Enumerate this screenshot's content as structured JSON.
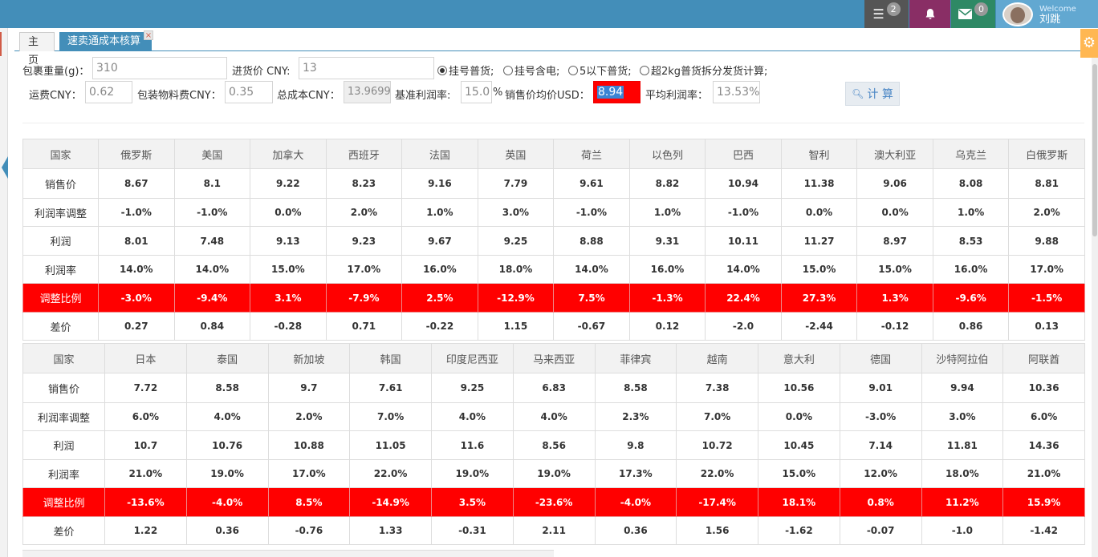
{
  "header": {
    "messages_badge": "2",
    "mail_badge": "0",
    "welcome": "Welcome",
    "username": "刘跳"
  },
  "tabs": [
    {
      "label": "主页"
    },
    {
      "label": "速卖通成本核算",
      "close": "×"
    }
  ],
  "form": {
    "weight_label": "包裹重量(g)：",
    "weight_value": "310",
    "purchase_label": "进货价 CNY:",
    "purchase_value": "13",
    "radio_options": [
      {
        "label": "挂号普货;",
        "checked": true
      },
      {
        "label": "挂号含电;",
        "checked": false
      },
      {
        "label": "5以下普货;",
        "checked": false
      },
      {
        "label": "超2kg普货拆分发货计算;",
        "checked": false
      }
    ],
    "freight_label": "运费CNY：",
    "freight_value": "0.62",
    "packaging_label": "包装物料费CNY：",
    "packaging_value": "0.35",
    "total_cost_label": "总成本CNY：",
    "total_cost_value": "13.9699",
    "base_margin_label": "基准利润率:",
    "base_margin_value": "15.0",
    "percent_sign": "%",
    "avg_price_label": "销售价均价USD：",
    "avg_price_value": "8.94",
    "avg_margin_label": "平均利润率：",
    "avg_margin_value": "13.53%",
    "calc_button": "计 算"
  },
  "row_labels": [
    "国家",
    "销售价",
    "利润率调整",
    "利润",
    "利润率",
    "调整比例",
    "差价"
  ],
  "table1": {
    "countries": [
      "俄罗斯",
      "美国",
      "加拿大",
      "西班牙",
      "法国",
      "英国",
      "荷兰",
      "以色列",
      "巴西",
      "智利",
      "澳大利亚",
      "乌克兰",
      "白俄罗斯"
    ],
    "rows": [
      [
        "8.67",
        "8.1",
        "9.22",
        "8.23",
        "9.16",
        "7.79",
        "9.61",
        "8.82",
        "10.94",
        "11.38",
        "9.06",
        "8.08",
        "8.81"
      ],
      [
        "-1.0%",
        "-1.0%",
        "0.0%",
        "2.0%",
        "1.0%",
        "3.0%",
        "-1.0%",
        "1.0%",
        "-1.0%",
        "0.0%",
        "0.0%",
        "1.0%",
        "2.0%"
      ],
      [
        "8.01",
        "7.48",
        "9.13",
        "9.23",
        "9.67",
        "9.25",
        "8.88",
        "9.31",
        "10.11",
        "11.27",
        "8.97",
        "8.53",
        "9.88"
      ],
      [
        "14.0%",
        "14.0%",
        "15.0%",
        "17.0%",
        "16.0%",
        "18.0%",
        "14.0%",
        "16.0%",
        "14.0%",
        "15.0%",
        "15.0%",
        "16.0%",
        "17.0%"
      ],
      [
        "-3.0%",
        "-9.4%",
        "3.1%",
        "-7.9%",
        "2.5%",
        "-12.9%",
        "7.5%",
        "-1.3%",
        "22.4%",
        "27.3%",
        "1.3%",
        "-9.6%",
        "-1.5%"
      ],
      [
        "0.27",
        "0.84",
        "-0.28",
        "0.71",
        "-0.22",
        "1.15",
        "-0.67",
        "0.12",
        "-2.0",
        "-2.44",
        "-0.12",
        "0.86",
        "0.13"
      ]
    ]
  },
  "table2": {
    "countries": [
      "日本",
      "泰国",
      "新加坡",
      "韩国",
      "印度尼西亚",
      "马来西亚",
      "菲律宾",
      "越南",
      "意大利",
      "德国",
      "沙特阿拉伯",
      "阿联酋"
    ],
    "rows": [
      [
        "7.72",
        "8.58",
        "9.7",
        "7.61",
        "9.25",
        "6.83",
        "8.58",
        "7.38",
        "10.56",
        "9.01",
        "9.94",
        "10.36"
      ],
      [
        "6.0%",
        "4.0%",
        "2.0%",
        "7.0%",
        "4.0%",
        "4.0%",
        "2.3%",
        "7.0%",
        "0.0%",
        "-3.0%",
        "3.0%",
        "6.0%"
      ],
      [
        "10.7",
        "10.76",
        "10.88",
        "11.05",
        "11.6",
        "8.56",
        "9.8",
        "10.72",
        "10.45",
        "7.14",
        "11.81",
        "14.36"
      ],
      [
        "21.0%",
        "19.0%",
        "17.0%",
        "22.0%",
        "19.0%",
        "19.0%",
        "17.3%",
        "22.0%",
        "15.0%",
        "12.0%",
        "18.0%",
        "21.0%"
      ],
      [
        "-13.6%",
        "-4.0%",
        "8.5%",
        "-14.9%",
        "3.5%",
        "-23.6%",
        "-4.0%",
        "-17.4%",
        "18.1%",
        "0.8%",
        "11.2%",
        "15.9%"
      ],
      [
        "1.22",
        "0.36",
        "-0.76",
        "1.33",
        "-0.31",
        "2.11",
        "0.36",
        "1.56",
        "-1.62",
        "-0.07",
        "-1.0",
        "-1.42"
      ]
    ]
  },
  "colors": {
    "topbar": "#438eb9",
    "highlight_row": "#ff0000"
  }
}
